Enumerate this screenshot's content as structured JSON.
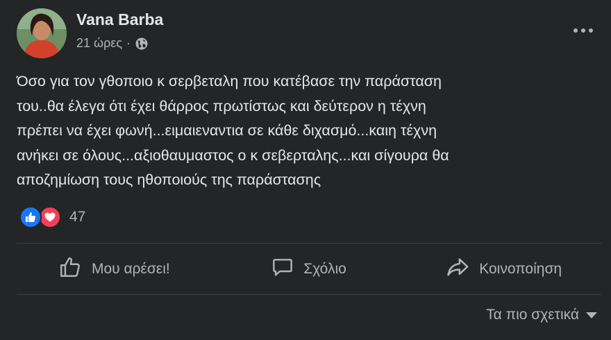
{
  "post": {
    "author": "Vana Barba",
    "time": "21 ώρες",
    "separator": "·",
    "visibility_icon": "globe-icon",
    "more_icon": "more-horizontal-icon",
    "text_lines": [
      "Όσο για τον γθοποιο κ σερβεταλη που κατέβασε την παράσταση",
      "του..θα έλεγα ότι έχει θάρρος πρωτίστως  και δεύτερον η τέχνη",
      "πρέπει να έχει φωνή...ειμαιεναντια σε κάθε διχασμό...καιη τέχνη",
      "ανήκει σε όλους...αξιοθαυμαστος ο κ σεβερταλης...και σίγουρα θα",
      "αποζημίωση τους ηθοποιούς της παράστασης"
    ]
  },
  "reactions": {
    "types": [
      "like-icon",
      "love-icon"
    ],
    "count": "47"
  },
  "actions": {
    "like_label": "Μου αρέσει!",
    "comment_label": "Σχόλιο",
    "share_label": "Κοινοποίηση"
  },
  "comments": {
    "sort_label": "Τα πιο σχετικά"
  },
  "colors": {
    "background": "#242526",
    "primary_text": "#e4e6eb",
    "secondary_text": "#b0b3b8",
    "divider": "#3e4042",
    "like_blue": "#1877f2",
    "love_red": "#f33e58"
  }
}
